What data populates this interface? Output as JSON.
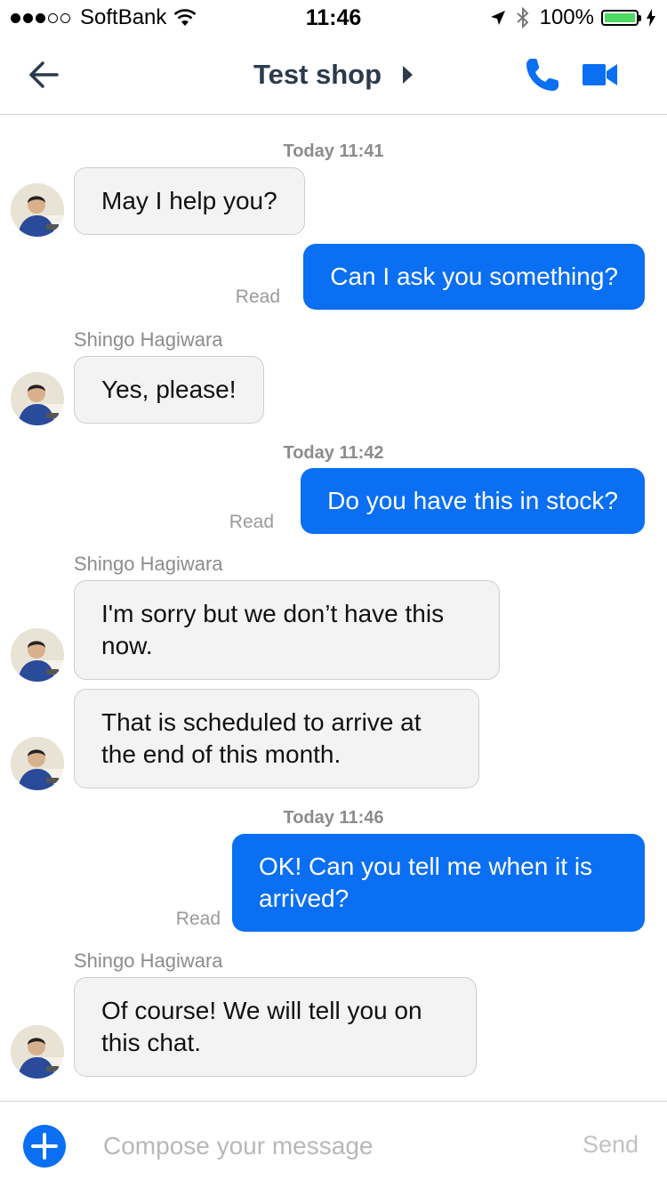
{
  "status_bar": {
    "carrier": "SoftBank",
    "time": "11:46",
    "battery": "100%",
    "signal_bars": 3,
    "signal_total": 5
  },
  "nav": {
    "title": "Test shop",
    "back_icon": "arrow-left-icon",
    "call_icon": "phone-icon",
    "video_icon": "video-camera-icon"
  },
  "chat": {
    "timestamps": [
      "Today 11:41",
      "Today 11:42",
      "Today 11:46"
    ],
    "read_label": "Read",
    "sender_name": "Shingo Hagiwara",
    "messages": [
      {
        "direction": "in",
        "text": "May I help you?"
      },
      {
        "direction": "out",
        "text": "Can I ask you something?"
      },
      {
        "direction": "in",
        "text": "Yes, please!"
      },
      {
        "direction": "out",
        "text": "Do you have this in stock?"
      },
      {
        "direction": "in",
        "text": "I'm sorry but we don’t have this now."
      },
      {
        "direction": "in",
        "text": "That is scheduled to arrive at the end of this month."
      },
      {
        "direction": "out",
        "text": "OK! Can you tell me when it is arrived?"
      },
      {
        "direction": "in",
        "text": "Of course! We will tell you on this chat."
      }
    ]
  },
  "compose": {
    "placeholder": "Compose your message",
    "send_label": "Send"
  },
  "colors": {
    "accent": "#0a6ff2",
    "title": "#2c3a4d",
    "battery": "#4cd964"
  }
}
